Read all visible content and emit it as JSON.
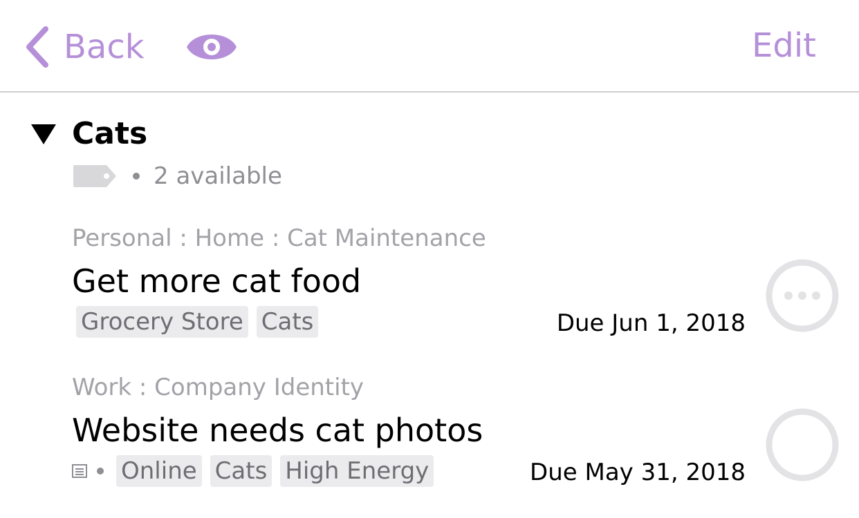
{
  "navbar": {
    "back_label": "Back",
    "back_icon": "chevron-left-icon",
    "view_icon": "eye-icon",
    "edit_label": "Edit",
    "accent_color": "#b590d9"
  },
  "group": {
    "title": "Cats",
    "disclosure_icon": "disclosure-triangle-icon",
    "tag_icon": "tag-icon",
    "available_text": "2 available"
  },
  "tasks": [
    {
      "path": "Personal : Home : Cat Maintenance",
      "title": "Get more cat food",
      "tags": [
        "Grocery Store",
        "Cats"
      ],
      "due": "Due Jun 1, 2018",
      "has_note": false,
      "status_icon": "more-circle-icon"
    },
    {
      "path": "Work : Company Identity",
      "title": "Website needs cat photos",
      "tags": [
        "Online",
        "Cats",
        "High Energy"
      ],
      "due": "Due May 31, 2018",
      "has_note": true,
      "status_icon": "empty-circle-icon"
    }
  ]
}
